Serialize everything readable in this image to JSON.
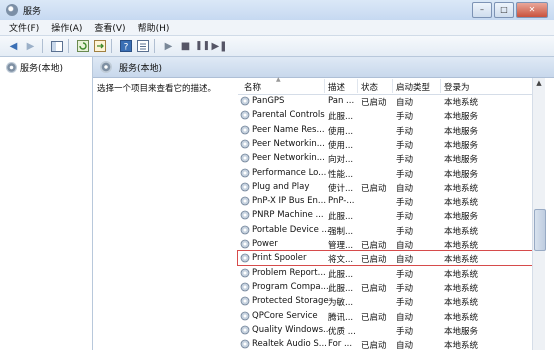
{
  "window": {
    "title": "服务"
  },
  "menu": [
    "文件(F)",
    "操作(A)",
    "查看(V)",
    "帮助(H)"
  ],
  "left_pane": {
    "node": "服务(本地)"
  },
  "right_pane": {
    "header": "服务(本地)",
    "description": "选择一个项目来查看它的描述。",
    "columns": {
      "name": "名称",
      "desc": "描述",
      "status": "状态",
      "startup": "启动类型",
      "logon": "登录为"
    },
    "rows": [
      {
        "name": "PanGPS",
        "desc": "Pan ...",
        "status": "已启动",
        "startup": "自动",
        "logon": "本地系统"
      },
      {
        "name": "Parental Controls",
        "desc": "此服...",
        "status": "",
        "startup": "手动",
        "logon": "本地服务"
      },
      {
        "name": "Peer Name Res...",
        "desc": "使用...",
        "status": "",
        "startup": "手动",
        "logon": "本地服务"
      },
      {
        "name": "Peer Networkin...",
        "desc": "使用...",
        "status": "",
        "startup": "手动",
        "logon": "本地服务"
      },
      {
        "name": "Peer Networkin...",
        "desc": "向对...",
        "status": "",
        "startup": "手动",
        "logon": "本地服务"
      },
      {
        "name": "Performance Lo...",
        "desc": "性能...",
        "status": "",
        "startup": "手动",
        "logon": "本地服务"
      },
      {
        "name": "Plug and Play",
        "desc": "使计...",
        "status": "已启动",
        "startup": "自动",
        "logon": "本地系统"
      },
      {
        "name": "PnP-X IP Bus En...",
        "desc": "PnP-...",
        "status": "",
        "startup": "手动",
        "logon": "本地系统"
      },
      {
        "name": "PNRP Machine ...",
        "desc": "此服...",
        "status": "",
        "startup": "手动",
        "logon": "本地服务"
      },
      {
        "name": "Portable Device ...",
        "desc": "强制...",
        "status": "",
        "startup": "手动",
        "logon": "本地系统"
      },
      {
        "name": "Power",
        "desc": "管理...",
        "status": "已启动",
        "startup": "自动",
        "logon": "本地系统"
      },
      {
        "name": "Print Spooler",
        "desc": "将文...",
        "status": "已启动",
        "startup": "自动",
        "logon": "本地系统"
      },
      {
        "name": "Problem Report...",
        "desc": "此服...",
        "status": "",
        "startup": "手动",
        "logon": "本地系统"
      },
      {
        "name": "Program Compa...",
        "desc": "此服...",
        "status": "已启动",
        "startup": "手动",
        "logon": "本地系统"
      },
      {
        "name": "Protected Storage",
        "desc": "为敏...",
        "status": "",
        "startup": "手动",
        "logon": "本地系统"
      },
      {
        "name": "QPCore Service",
        "desc": "腾讯...",
        "status": "已启动",
        "startup": "自动",
        "logon": "本地系统"
      },
      {
        "name": "Quality Windows...",
        "desc": "优质 ...",
        "status": "",
        "startup": "手动",
        "logon": "本地服务"
      },
      {
        "name": "Realtek Audio S...",
        "desc": "For ...",
        "status": "已启动",
        "startup": "自动",
        "logon": "本地系统"
      }
    ]
  },
  "highlight_color": "#d64b4b"
}
